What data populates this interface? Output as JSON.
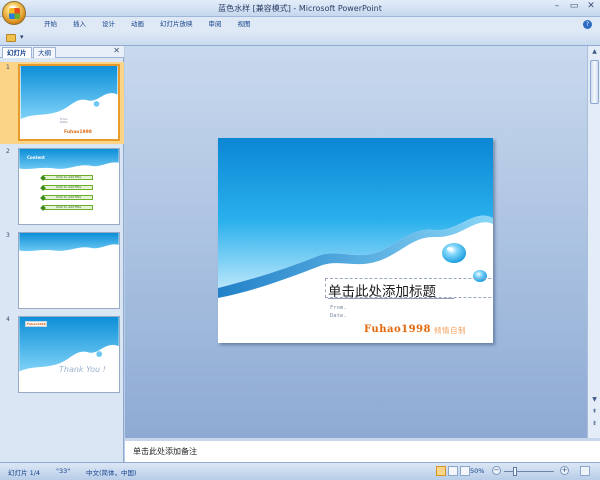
{
  "window": {
    "title": "蓝色水样 [兼容模式] - Microsoft PowerPoint",
    "controls": [
      "–",
      "▭",
      "✕"
    ]
  },
  "ribbon": {
    "tabs": [
      "开始",
      "插入",
      "设计",
      "动画",
      "幻灯片放映",
      "审阅",
      "视图"
    ],
    "help_icon": "?"
  },
  "quick_access": {
    "more": "▾"
  },
  "left_pane": {
    "tabs": [
      "幻灯片",
      "大纲"
    ],
    "close": "✕",
    "slides": [
      {
        "number": "1",
        "brand": "Fuhao1998",
        "lines": "From.\nDate."
      },
      {
        "number": "2",
        "title": "Content",
        "bullets": [
          "Click to add Title",
          "Click to add Title",
          "Click to add Title",
          "Click to add Title"
        ]
      },
      {
        "number": "3"
      },
      {
        "number": "4",
        "chip": "Fuhao1998",
        "thank": "Thank You !"
      }
    ]
  },
  "slide": {
    "title_placeholder": "单击此处添加标题",
    "from": "From.",
    "date": "Date.",
    "brand": "Fuhao1998",
    "brand_sub": "倾情自制"
  },
  "notes": {
    "placeholder": "单击此处添加备注"
  },
  "statusbar": {
    "slide_info": "幻灯片 1/4",
    "theme": "\"33\"",
    "language": "中文(简体，中国)",
    "zoom": "50%"
  },
  "colors": {
    "accent": "#15428b",
    "brand": "#e06a12",
    "wave": "#1a9fe0"
  }
}
